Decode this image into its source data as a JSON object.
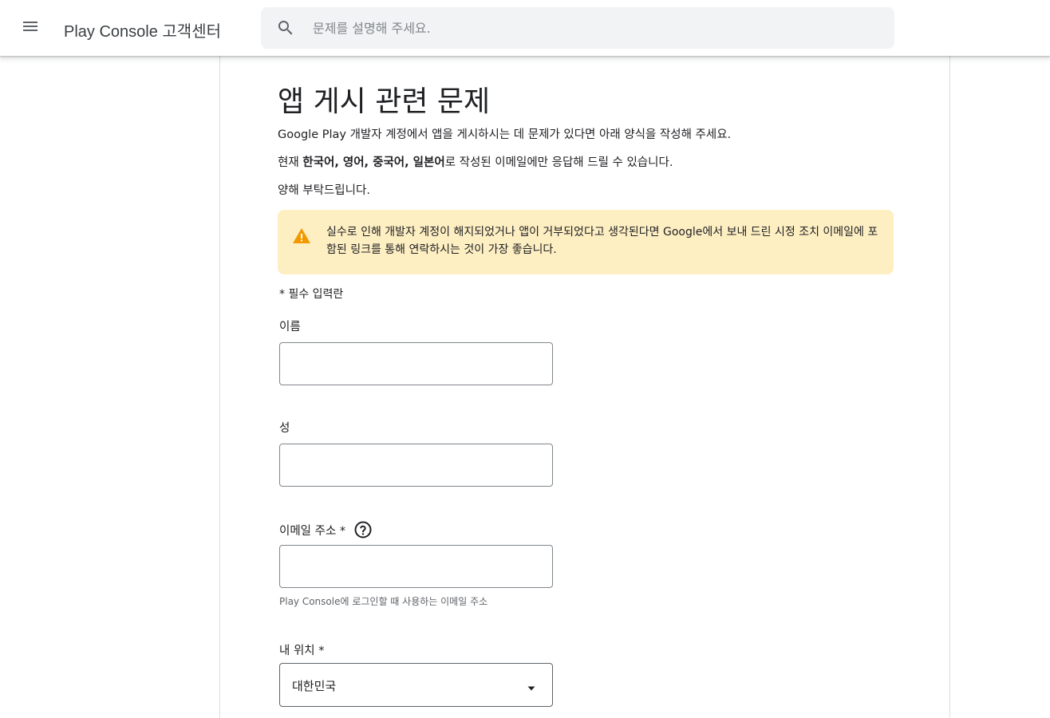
{
  "header": {
    "menu_icon": "menu-icon",
    "app_title": "Play Console 고객센터",
    "search": {
      "icon": "search-icon",
      "placeholder": "문제를 설명해 주세요.",
      "value": ""
    }
  },
  "page": {
    "title": "앱 게시 관련 문제",
    "intro_line1": "Google Play 개발자 계정에서 앱을 게시하시는 데 문제가 있다면 아래 양식을 작성해 주세요.",
    "intro_line2_prefix": "현재 ",
    "intro_line2_languages": "한국어, 영어, 중국어, 일본어",
    "intro_line2_suffix": "로 작성된 이메일에만 응답해 드릴 수 있습니다.",
    "intro_line3": "양해 부탁드립니다.",
    "warning": {
      "icon": "warning-icon",
      "text": "실수로 인해 개발자 계정이 해지되었거나 앱이 거부되었다고 생각된다면 Google에서 보내 드린 시정 조치 이메일에 포함된 링크를 통해 연락하시는 것이 가장 좋습니다."
    },
    "required_note": "* 필수 입력란"
  },
  "form": {
    "first_name": {
      "label": "이름",
      "value": ""
    },
    "last_name": {
      "label": "성",
      "value": ""
    },
    "email": {
      "label": "이메일 주소 *",
      "help_icon": "help-circle-icon",
      "value": "",
      "hint": "Play Console에 로그인할 때 사용하는 이메일 주소"
    },
    "location": {
      "label": "내 위치 *",
      "selected": "대한민국",
      "arrow_icon": "dropdown-arrow-icon"
    }
  },
  "colors": {
    "warning_bg": "#feefc3",
    "warning_icon": "#f29900",
    "search_bg": "#f1f3f4",
    "border": "#dadce0"
  }
}
